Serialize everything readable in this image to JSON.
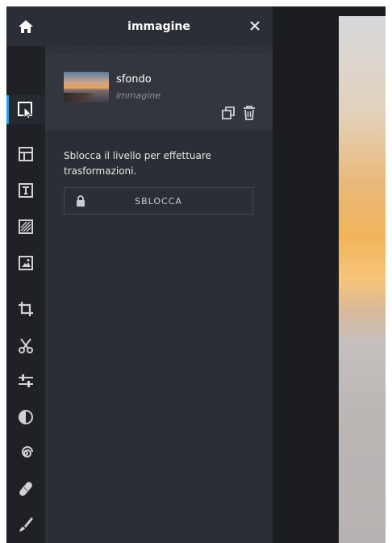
{
  "panel": {
    "title": "immagine",
    "layer": {
      "name": "sfondo",
      "type": "immagine"
    },
    "message": "Sblocca il livello per effettuare trasformazioni.",
    "unlock_label": "SBLOCCA"
  },
  "toolbar": {
    "items": [
      {
        "icon": "home-icon"
      },
      {
        "icon": "arrange-icon",
        "active": true
      },
      {
        "icon": "layout-icon"
      },
      {
        "icon": "text-icon"
      },
      {
        "icon": "texture-icon"
      },
      {
        "icon": "image-icon"
      },
      {
        "icon": "crop-icon"
      },
      {
        "icon": "cut-icon"
      },
      {
        "icon": "adjust-icon"
      },
      {
        "icon": "contrast-icon"
      },
      {
        "icon": "spiral-icon"
      },
      {
        "icon": "bandage-icon"
      },
      {
        "icon": "brush-icon"
      }
    ]
  },
  "colors": {
    "accent": "#2aa0d8",
    "panel": "#2b2e34",
    "toolbar": "#1f2126",
    "canvas": "#1b1d21"
  }
}
